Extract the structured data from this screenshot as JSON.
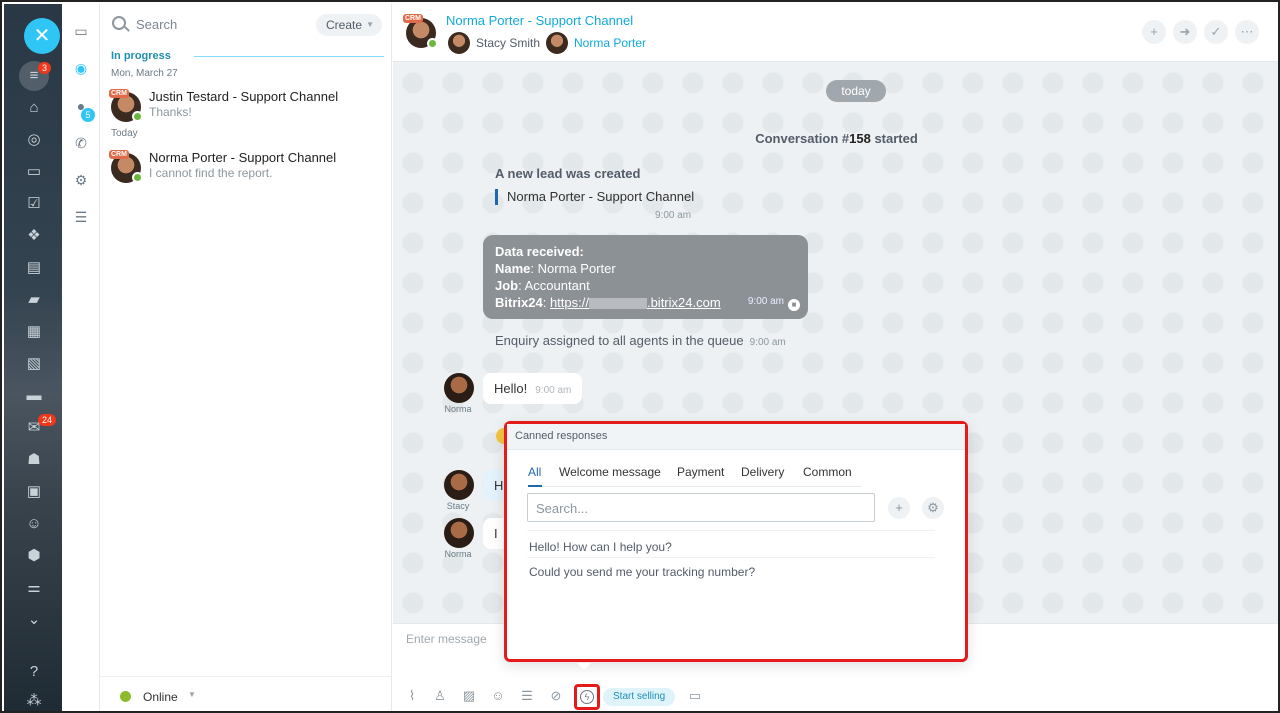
{
  "rail": {
    "badge_feed": "3",
    "badge_mail": "24"
  },
  "rail2": {
    "badge_notifications": "5"
  },
  "list": {
    "search_placeholder": "Search",
    "create_label": "Create",
    "section_title": "In progress",
    "groups": [
      {
        "date": "Mon, March 27",
        "item": {
          "title": "Justin Testard - Support Channel",
          "message": "Thanks!",
          "tag": "CRM"
        }
      },
      {
        "date": "Today",
        "item": {
          "title": "Norma Porter - Support Channel",
          "message": "I cannot find the report.",
          "tag": "CRM"
        }
      }
    ],
    "status": "Online"
  },
  "header": {
    "title": "Norma Porter - Support Channel",
    "tag": "CRM",
    "member1": "Stacy Smith",
    "member2": "Norma Porter"
  },
  "conversation": {
    "date_pill": "today",
    "started_prefix": "Conversation #",
    "started_number": "158",
    "started_suffix": " started",
    "lead_title": "A new lead was created",
    "lead_link": "Norma Porter - Support Channel",
    "lead_time": "9:00 am",
    "data_received": {
      "heading": "Data received:",
      "name_label": "Name",
      "name_value": "Norma Porter",
      "job_label": "Job",
      "job_value": "Accountant",
      "site_label": "Bitrix24",
      "site_prefix": "https://",
      "site_suffix": ".bitrix24.com",
      "time": "9:00 am"
    },
    "assigned_text": "Enquiry assigned to all agents in the queue",
    "assigned_time": "9:00 am",
    "messages": [
      {
        "author": "Norma",
        "text": "Hello!",
        "time": "9:00 am"
      },
      {
        "author": "Stacy",
        "text": "H",
        "time": ""
      },
      {
        "author": "Norma",
        "text": "I",
        "time": ""
      }
    ]
  },
  "input": {
    "placeholder": "Enter message",
    "start_selling": "Start selling"
  },
  "canned": {
    "title": "Canned responses",
    "tabs": [
      "All",
      "Welcome message",
      "Payment",
      "Delivery",
      "Common"
    ],
    "search_placeholder": "Search...",
    "items": [
      "Hello! How can I help you?",
      "Could you send me your tracking number?"
    ]
  },
  "colors": {
    "accent": "#2fc6f6",
    "link": "#11a9d8",
    "highlight": "#e41b1b",
    "online": "#8dbb2b"
  }
}
